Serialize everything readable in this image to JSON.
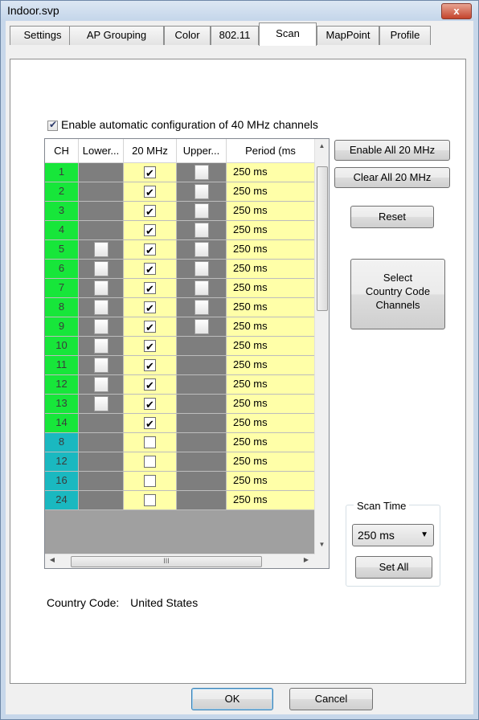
{
  "window": {
    "title": "Indoor.svp",
    "close_label": "x"
  },
  "tabs": [
    {
      "label": "Settings",
      "active": false
    },
    {
      "label": "AP Grouping",
      "active": false
    },
    {
      "label": "Color",
      "active": false
    },
    {
      "label": "802.11",
      "active": false
    },
    {
      "label": "Scan",
      "active": true
    },
    {
      "label": "MapPoint",
      "active": false
    },
    {
      "label": "Profile",
      "active": false
    }
  ],
  "scan": {
    "enable40_label": "Enable automatic configuration of 40 MHz channels",
    "enable40_checked": true,
    "grid": {
      "headers": [
        "CH",
        "Lower...",
        "20 MHz",
        "Upper...",
        "Period (ms"
      ],
      "rows": [
        {
          "ch": "1",
          "band": "2.4",
          "lower": null,
          "mhz20": true,
          "upper": false,
          "period": "250 ms"
        },
        {
          "ch": "2",
          "band": "2.4",
          "lower": null,
          "mhz20": true,
          "upper": false,
          "period": "250 ms"
        },
        {
          "ch": "3",
          "band": "2.4",
          "lower": null,
          "mhz20": true,
          "upper": false,
          "period": "250 ms"
        },
        {
          "ch": "4",
          "band": "2.4",
          "lower": null,
          "mhz20": true,
          "upper": false,
          "period": "250 ms"
        },
        {
          "ch": "5",
          "band": "2.4",
          "lower": false,
          "mhz20": true,
          "upper": false,
          "period": "250 ms"
        },
        {
          "ch": "6",
          "band": "2.4",
          "lower": false,
          "mhz20": true,
          "upper": false,
          "period": "250 ms"
        },
        {
          "ch": "7",
          "band": "2.4",
          "lower": false,
          "mhz20": true,
          "upper": false,
          "period": "250 ms"
        },
        {
          "ch": "8",
          "band": "2.4",
          "lower": false,
          "mhz20": true,
          "upper": false,
          "period": "250 ms"
        },
        {
          "ch": "9",
          "band": "2.4",
          "lower": false,
          "mhz20": true,
          "upper": false,
          "period": "250 ms"
        },
        {
          "ch": "10",
          "band": "2.4",
          "lower": false,
          "mhz20": true,
          "upper": null,
          "period": "250 ms"
        },
        {
          "ch": "11",
          "band": "2.4",
          "lower": false,
          "mhz20": true,
          "upper": null,
          "period": "250 ms"
        },
        {
          "ch": "12",
          "band": "2.4",
          "lower": false,
          "mhz20": true,
          "upper": null,
          "period": "250 ms"
        },
        {
          "ch": "13",
          "band": "2.4",
          "lower": false,
          "mhz20": true,
          "upper": null,
          "period": "250 ms"
        },
        {
          "ch": "14",
          "band": "2.4",
          "lower": null,
          "mhz20": true,
          "upper": null,
          "period": "250 ms"
        },
        {
          "ch": "8",
          "band": "5",
          "lower": null,
          "mhz20": false,
          "upper": null,
          "period": "250 ms"
        },
        {
          "ch": "12",
          "band": "5",
          "lower": null,
          "mhz20": false,
          "upper": null,
          "period": "250 ms"
        },
        {
          "ch": "16",
          "band": "5",
          "lower": null,
          "mhz20": false,
          "upper": null,
          "period": "250 ms"
        },
        {
          "ch": "24",
          "band": "5",
          "lower": null,
          "mhz20": false,
          "upper": null,
          "period": "250 ms"
        }
      ],
      "hscroll_grip": "III"
    },
    "buttons": {
      "enable_all": "Enable All 20 MHz",
      "clear_all": "Clear All 20 MHz",
      "reset": "Reset",
      "select_cc": "Select\nCountry Code\nChannels"
    },
    "scan_time": {
      "group_label": "Scan Time",
      "selected": "250 ms",
      "set_all": "Set All"
    },
    "country_label": "Country Code:",
    "country_value": "United States"
  },
  "footer": {
    "ok": "OK",
    "cancel": "Cancel"
  },
  "colors": {
    "band24": "#17e63a",
    "band5": "#1ab8c0",
    "cell_yellow": "#ffffa8",
    "cell_gray": "#7e7e7e"
  }
}
